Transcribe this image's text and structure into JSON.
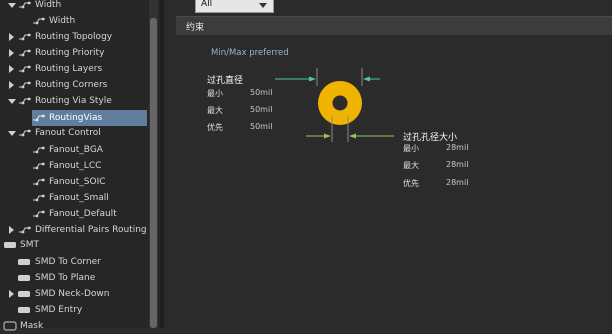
{
  "tree": {
    "items": [
      {
        "label": "Width",
        "arrow": "down"
      },
      {
        "label": "Width",
        "arrow": ""
      },
      {
        "label": "Routing Topology",
        "arrow": "right"
      },
      {
        "label": "Routing Priority",
        "arrow": "right"
      },
      {
        "label": "Routing Layers",
        "arrow": "right"
      },
      {
        "label": "Routing Corners",
        "arrow": "right"
      },
      {
        "label": "Routing Via Style",
        "arrow": "down"
      },
      {
        "label": "RoutingVias",
        "arrow": ""
      },
      {
        "label": "Fanout Control",
        "arrow": "down"
      },
      {
        "label": "Fanout_BGA",
        "arrow": ""
      },
      {
        "label": "Fanout_LCC",
        "arrow": ""
      },
      {
        "label": "Fanout_SOIC",
        "arrow": ""
      },
      {
        "label": "Fanout_Small",
        "arrow": ""
      },
      {
        "label": "Fanout_Default",
        "arrow": ""
      },
      {
        "label": "Differential Pairs Routing",
        "arrow": "right"
      },
      {
        "label": "SMT",
        "arrow": "down"
      },
      {
        "label": "SMD To Corner",
        "arrow": ""
      },
      {
        "label": "SMD To Plane",
        "arrow": ""
      },
      {
        "label": "SMD Neck-Down",
        "arrow": "right"
      },
      {
        "label": "SMD Entry",
        "arrow": ""
      },
      {
        "label": "Mask",
        "arrow": "down"
      }
    ]
  },
  "dropdown": {
    "value": "All"
  },
  "section": {
    "title": "约束"
  },
  "constraints": {
    "mode_label": "Min/Max preferred",
    "via_diameter": {
      "title": "过孔直径",
      "rows": [
        {
          "label": "最小",
          "value": "50mil"
        },
        {
          "label": "最大",
          "value": "50mil"
        },
        {
          "label": "优先",
          "value": "50mil"
        }
      ]
    },
    "hole_size": {
      "title": "过孔孔径大小",
      "rows": [
        {
          "label": "最小",
          "value": "28mil"
        },
        {
          "label": "最大",
          "value": "28mil"
        },
        {
          "label": "优先",
          "value": "28mil"
        }
      ]
    }
  },
  "colors": {
    "via_pad": "#f0b400",
    "via_hole": "#2b2b2b",
    "dim_line": "#4fc7a8",
    "selection": "#5f7d9d"
  }
}
